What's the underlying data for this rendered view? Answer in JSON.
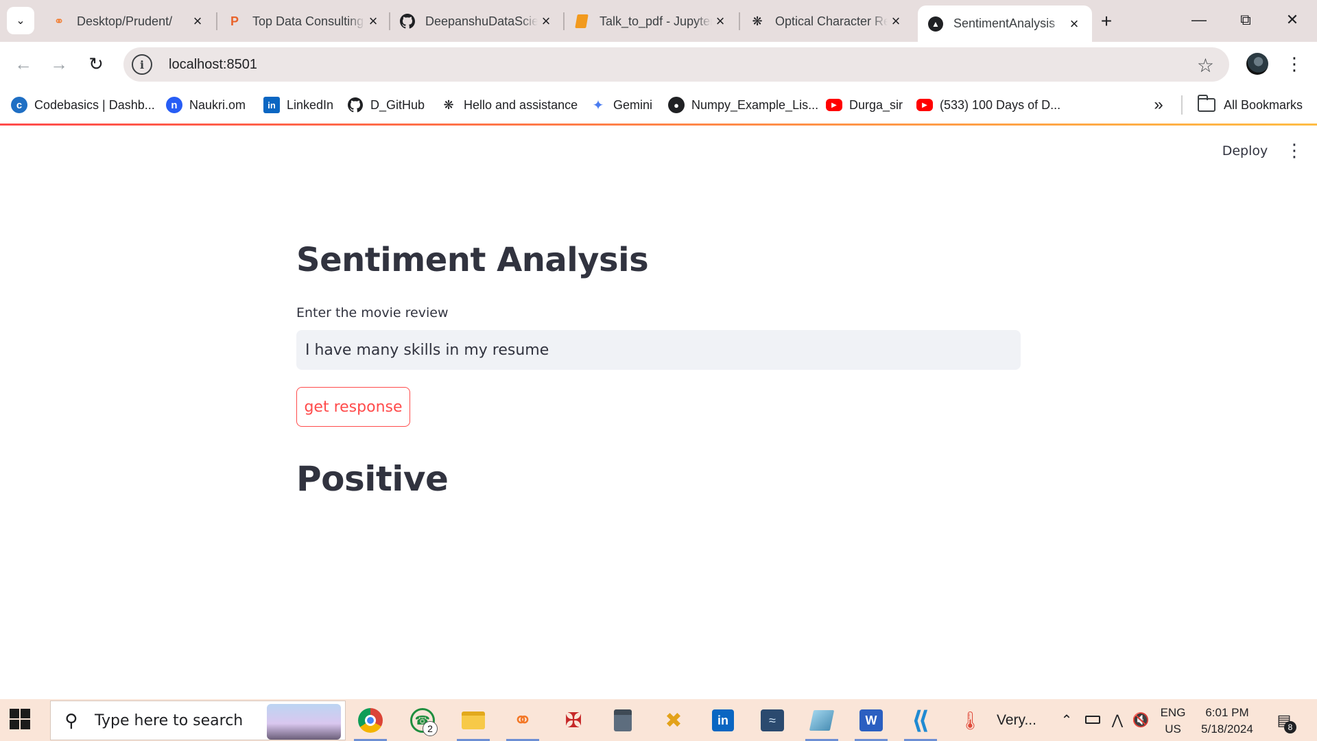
{
  "browser": {
    "tabs": [
      {
        "title": "Desktop/Prudent/",
        "icon": "jupyter-icon",
        "active": false
      },
      {
        "title": "Top Data Consulting",
        "icon": "prudent-icon",
        "active": false
      },
      {
        "title": "DeepanshuDataScience",
        "icon": "github-icon",
        "active": false
      },
      {
        "title": "Talk_to_pdf - Jupyter",
        "icon": "book-icon",
        "active": false
      },
      {
        "title": "Optical Character Recognition",
        "icon": "openai-icon",
        "active": false
      },
      {
        "title": "SentimentAnalysis",
        "icon": "streamlit-icon",
        "active": true
      }
    ],
    "address": "localhost:8501",
    "bookmarks": [
      {
        "label": "Codebasics | Dashb...",
        "icon": "codebasics-icon"
      },
      {
        "label": "Naukri.om",
        "icon": "naukri-icon"
      },
      {
        "label": "LinkedIn",
        "icon": "linkedin-icon"
      },
      {
        "label": "D_GitHub",
        "icon": "github-icon"
      },
      {
        "label": "Hello and assistance",
        "icon": "openai-icon"
      },
      {
        "label": "Gemini",
        "icon": "gemini-icon"
      },
      {
        "label": "Numpy_Example_Lis...",
        "icon": "globe-icon"
      },
      {
        "label": "Durga_sir",
        "icon": "youtube-icon"
      },
      {
        "label": "(533) 100 Days of D...",
        "icon": "youtube-icon"
      }
    ],
    "all_bookmarks_label": "All Bookmarks",
    "colors": {
      "accent": "#ff4b4b",
      "tabstrip": "#e7dede",
      "omnibox": "#ece6e6"
    }
  },
  "app": {
    "deploy_label": "Deploy",
    "title": "Sentiment Analysis",
    "input_label": "Enter the movie review",
    "input_value": "I have many skills in my resume",
    "button_label": "get response",
    "result": "Positive"
  },
  "taskbar": {
    "search_placeholder": "Type here to search",
    "whatsapp_badge": "2",
    "weather_text": "Very...",
    "language_line1": "ENG",
    "language_line2": "US",
    "time": "6:01 PM",
    "date": "5/18/2024",
    "notification_count": "8"
  }
}
